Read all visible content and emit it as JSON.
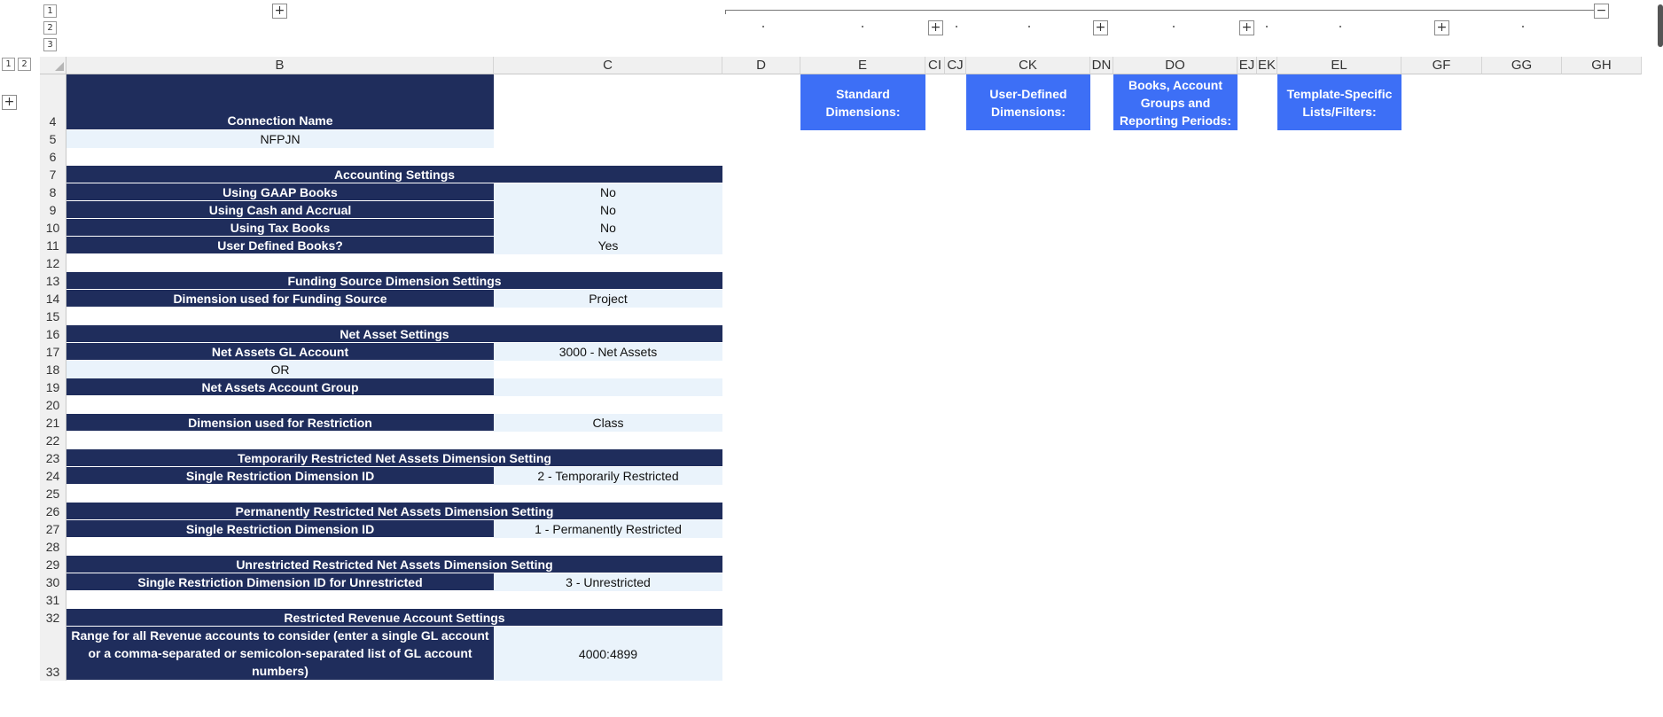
{
  "outline": {
    "top_levels": [
      "1",
      "2",
      "3"
    ],
    "left_levels": [
      "1",
      "2"
    ],
    "expand_symbol": "+",
    "collapse_symbol": "−"
  },
  "columns": [
    "B",
    "C",
    "D",
    "E",
    "CI",
    "CJ",
    "CK",
    "DN",
    "DO",
    "EJ",
    "EK",
    "EL",
    "GF",
    "GG",
    "GH"
  ],
  "rows": [
    "4",
    "5",
    "6",
    "7",
    "8",
    "9",
    "10",
    "11",
    "12",
    "13",
    "14",
    "15",
    "16",
    "17",
    "18",
    "19",
    "20",
    "21",
    "22",
    "23",
    "24",
    "25",
    "26",
    "27",
    "28",
    "29",
    "30",
    "31",
    "32",
    "33"
  ],
  "cells": {
    "connection_name_label": "Connection Name",
    "connection_name_value": "NFPJN",
    "accounting_header": "Accounting Settings",
    "gaap_label": "Using GAAP Books",
    "gaap_value": "No",
    "cash_accrual_label": "Using Cash and Accrual",
    "cash_accrual_value": "No",
    "tax_label": "Using Tax Books",
    "tax_value": "No",
    "user_books_label": "User Defined Books?",
    "user_books_value": "Yes",
    "funding_header": "Funding Source Dimension Settings",
    "funding_label": "Dimension used for Funding Source",
    "funding_value": "Project",
    "net_asset_header": "Net Asset Settings",
    "na_gl_label": "Net Assets GL Account",
    "na_gl_value": "3000 - Net Assets",
    "or_text": "OR",
    "na_group_label": "Net Assets Account Group",
    "na_group_value": "",
    "restriction_label": "Dimension used for Restriction",
    "restriction_value": "Class",
    "temp_header": "Temporarily Restricted Net Assets Dimension Setting",
    "temp_label": "Single Restriction Dimension ID",
    "temp_value": "2 - Temporarily Restricted",
    "perm_header": "Permanently Restricted Net Assets Dimension Setting",
    "perm_label": "Single Restriction Dimension ID",
    "perm_value": "1 - Permanently Restricted",
    "unres_header": "Unrestricted Restricted Net Assets Dimension Setting",
    "unres_label": "Single Restriction Dimension ID for Unrestricted",
    "unres_value": "3 - Unrestricted",
    "revenue_header": "Restricted Revenue Account Settings",
    "revenue_label": "Range for all Revenue accounts to consider (enter a single GL account or a comma-separated or semicolon-separated list of GL account numbers)",
    "revenue_value": "4000:4899"
  },
  "section_boxes": {
    "standard": "Standard Dimensions:",
    "user_defined": "User-Defined Dimensions:",
    "books": "Books, Account Groups and Reporting Periods:",
    "template": "Template-Specific Lists/Filters:"
  },
  "colors": {
    "navy": "#1f2d5c",
    "value_fill": "#eaf3fb",
    "blue_box": "#3d6ff6",
    "header_gray": "#f0f0f0"
  }
}
